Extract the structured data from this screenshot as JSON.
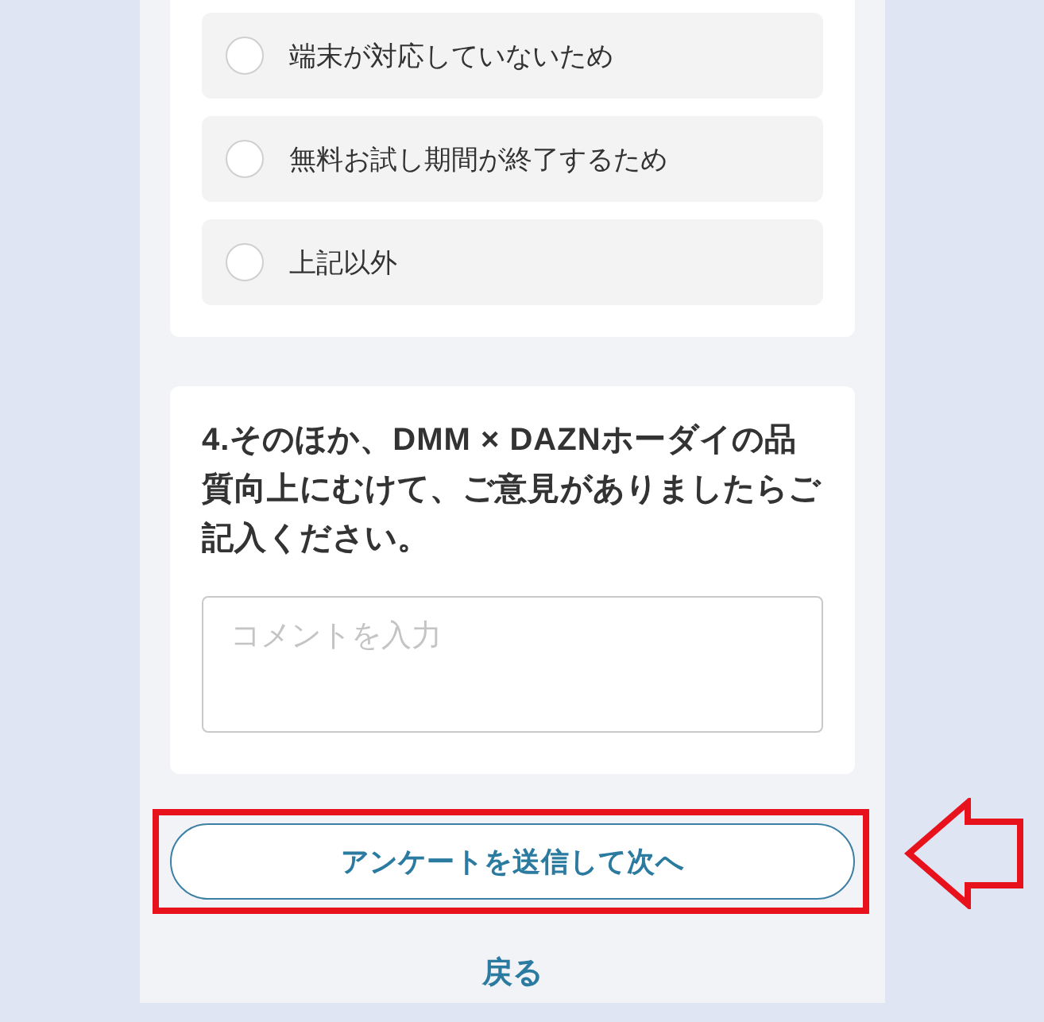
{
  "options": [
    {
      "label": "端末が対応していないため",
      "selected": false
    },
    {
      "label": "無料お試し期間が終了するため",
      "selected": false
    },
    {
      "label": "上記以外",
      "selected": false
    }
  ],
  "question": {
    "title": "4.そのほか、DMM × DAZNホーダイの品質向上にむけて、ご意見がありましたらご記入ください。",
    "comment": {
      "placeholder": "コメントを入力"
    }
  },
  "submit_button": {
    "label": "アンケートを送信して次へ",
    "highlighted": true
  },
  "back_link": {
    "label": "戻る"
  }
}
